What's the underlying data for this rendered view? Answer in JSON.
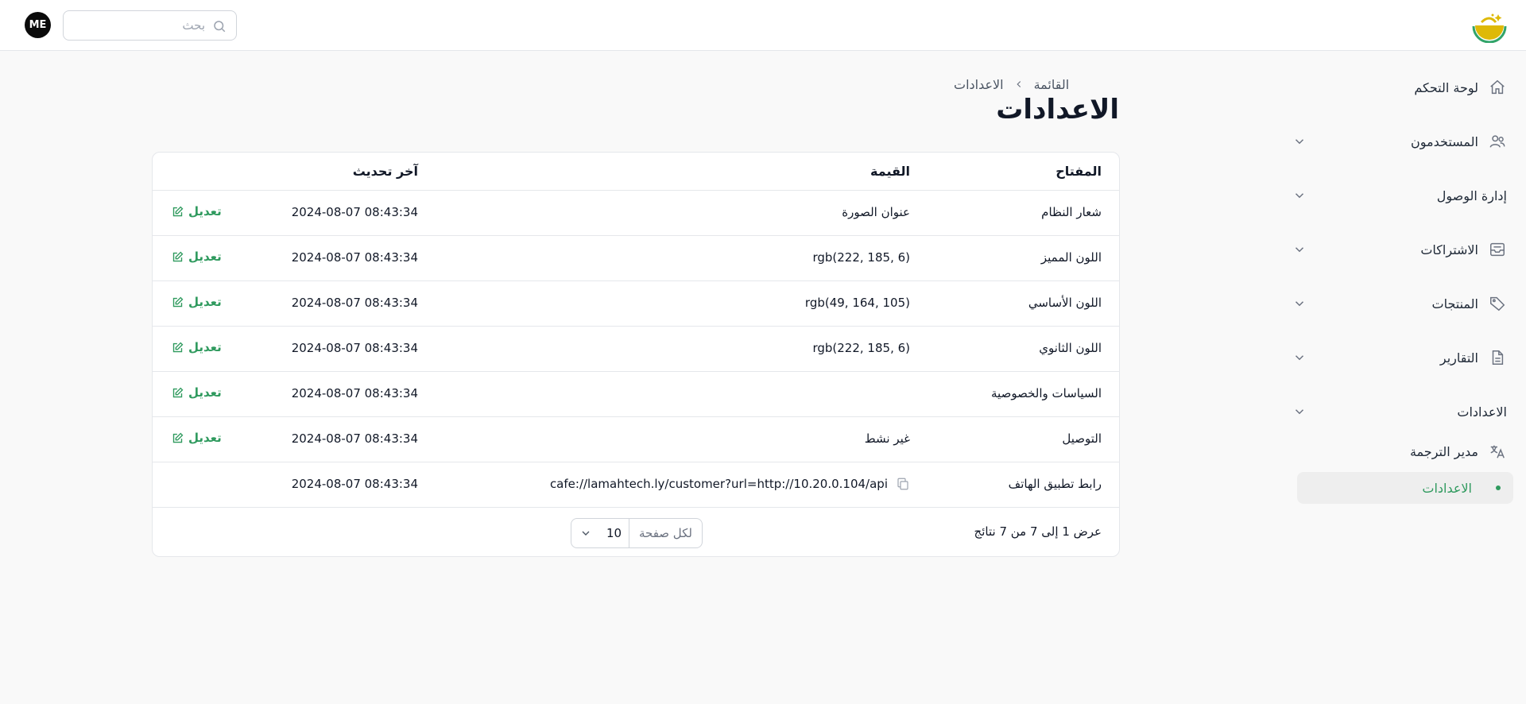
{
  "header": {
    "avatar_initials": "ME",
    "search_placeholder": "بحث"
  },
  "sidebar": {
    "items": [
      {
        "label": "لوحة التحكم",
        "icon": "home-icon"
      },
      {
        "label": "المستخدمون",
        "icon": "users-icon"
      },
      {
        "label": "إدارة الوصول",
        "icon": ""
      },
      {
        "label": "الاشتراكات",
        "icon": "inbox-icon"
      },
      {
        "label": "المنتجات",
        "icon": "tag-icon"
      },
      {
        "label": "التقارير",
        "icon": "document-icon"
      },
      {
        "label": "الاعدادات",
        "icon": ""
      }
    ],
    "sub_items": [
      {
        "label": "مدير الترجمة",
        "icon": "translate-icon"
      },
      {
        "label": "الاعدادات",
        "active": true
      }
    ]
  },
  "breadcrumb": {
    "root": "الاعدادات",
    "current": "القائمة"
  },
  "page_title": "الاعدادات",
  "table": {
    "headers": {
      "key": "المفتاح",
      "value": "القيمة",
      "updated": "آخر تحديث"
    },
    "edit_label": "تعديل",
    "rows": [
      {
        "key": "شعار النظام",
        "value": "عنوان الصورة",
        "updated": "2024-08-07 08:43:34"
      },
      {
        "key": "اللون المميز",
        "value": "rgb(222, 185, 6)",
        "updated": "2024-08-07 08:43:34"
      },
      {
        "key": "اللون الأساسي",
        "value": "rgb(49, 164, 105)",
        "updated": "2024-08-07 08:43:34"
      },
      {
        "key": "اللون الثانوي",
        "value": "rgb(222, 185, 6)",
        "updated": "2024-08-07 08:43:34"
      },
      {
        "key": "السياسات والخصوصية",
        "value": "",
        "updated": "2024-08-07 08:43:34"
      },
      {
        "key": "التوصيل",
        "value": "غير نشط",
        "updated": "2024-08-07 08:43:34"
      },
      {
        "key": "رابط تطبيق الهاتف",
        "value": "cafe://lamahtech.ly/customer?url=http://10.20.0.104/api",
        "updated": "2024-08-07 08:43:34"
      }
    ],
    "footer_text": "عرض 1 إلى 7 من 7 نتائج",
    "per_page_label": "لكل صفحة",
    "per_page_value": "10"
  },
  "colors": {
    "accent": "#2f9a5e",
    "brand_yellow": "#deb906",
    "brand_green": "#31a469"
  }
}
